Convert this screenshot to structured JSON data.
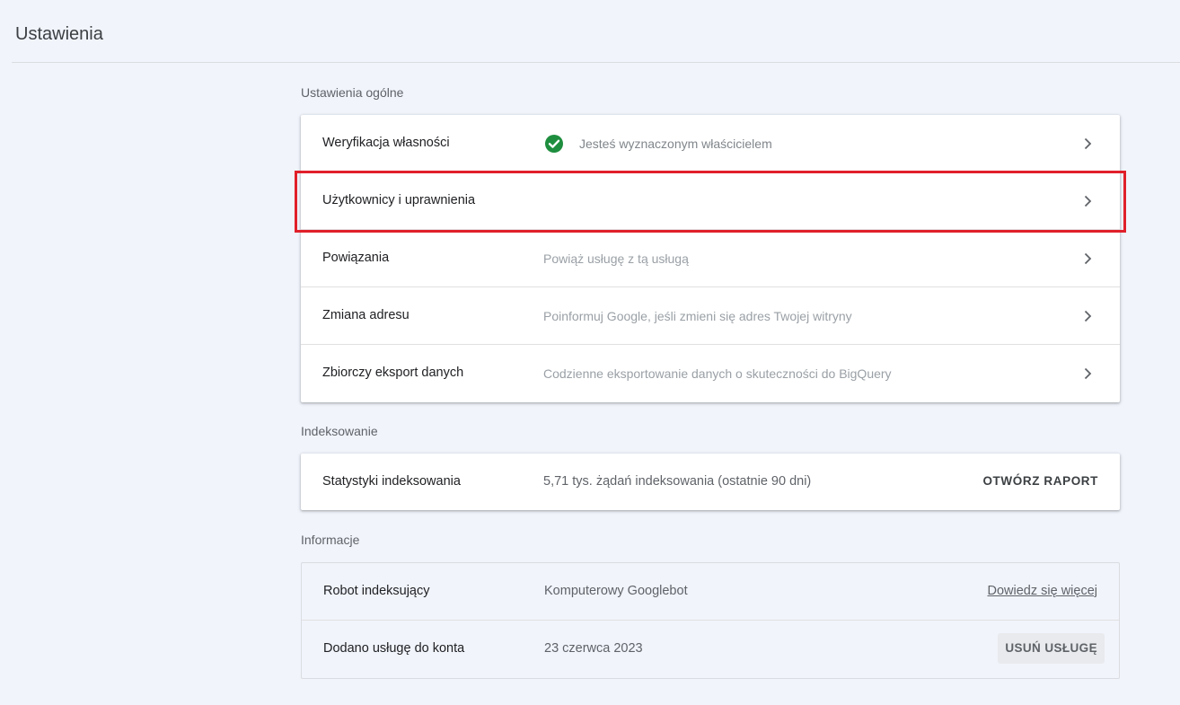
{
  "header": {
    "title": "Ustawienia"
  },
  "general": {
    "label": "Ustawienia ogólne",
    "rows": [
      {
        "title": "Weryfikacja własności",
        "desc": "Jesteś wyznaczonym właścicielem",
        "icon": "check-circle-icon",
        "icon_color": "#1e8e3e"
      },
      {
        "title": "Użytkownicy i uprawnienia",
        "desc": ""
      },
      {
        "title": "Powiązania",
        "desc": "Powiąż usługę z tą usługą"
      },
      {
        "title": "Zmiana adresu",
        "desc": "Poinformuj Google, jeśli zmieni się adres Twojej witryny"
      },
      {
        "title": "Zbiorczy eksport danych",
        "desc": "Codzienne eksportowanie danych o skuteczności do BigQuery"
      }
    ]
  },
  "indexing": {
    "label": "Indeksowanie",
    "row": {
      "title": "Statystyki indeksowania",
      "value": "5,71 tys. żądań indeksowania (ostatnie 90 dni)",
      "action": "OTWÓRZ RAPORT"
    }
  },
  "info": {
    "label": "Informacje",
    "rows": [
      {
        "title": "Robot indeksujący",
        "value": "Komputerowy Googlebot",
        "action": "Dowiedz się więcej"
      },
      {
        "title": "Dodano usługę do konta",
        "value": "23 czerwca 2023",
        "action": "USUŃ USŁUGĘ"
      }
    ]
  },
  "colors": {
    "highlight": "#e0202a",
    "background": "#f1f4fb"
  }
}
